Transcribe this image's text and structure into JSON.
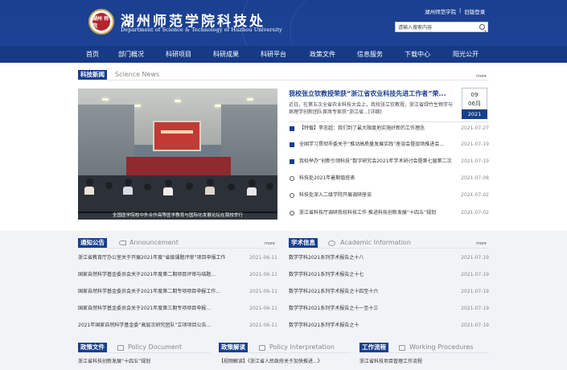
{
  "header": {
    "logo_text": "湖州\n师院",
    "title": "湖州师范学院科技处",
    "subtitle": "Department of Science & Technology of Huzhou University",
    "links": [
      "湖州师范学院",
      "|",
      "旧版登录"
    ],
    "search_placeholder": "请输入搜索内容"
  },
  "nav": {
    "items": [
      "首页",
      "部门概况",
      "科研项目",
      "科研成果",
      "科研平台",
      "政策文件",
      "信息服务",
      "下载中心",
      "阳光公开"
    ]
  },
  "news": {
    "title_cn": "科技新闻",
    "title_en": "Science News",
    "more": "more",
    "hero_caption": "全国医学院校中外合作高等医学教育与国际化发展论坛在我校举行",
    "headline": {
      "title": "我校张立钦教授荣获“浙江省农业科技先进工作者”荣...",
      "summary": "近日，在第五次全省农业科技大会上，我校张立钦教授，浙江省绿竹生物学与病理学创新团队首席专家获“浙江省...[详细]",
      "day": "09",
      "month": "06月",
      "year": "2021"
    },
    "items": [
      {
        "title": "【特载】李忠超：我们到了最大限度地实施好新的工作理念",
        "date": "2021-07-27"
      },
      {
        "title": "全国学习贯彻市委关于“推动高质量发展实践”座谈会暨现场推进会...",
        "date": "2021-07-19"
      },
      {
        "title": "我校举办“创新引领科技”数字研究会2021年学术研讨会暨第七届第二次...",
        "date": "2021-07-19"
      },
      {
        "title": "科技处2021年暑期值班表",
        "date": "2021-07-08"
      },
      {
        "title": "科技处深入二级学院开展调研座谈",
        "date": "2021-07-02"
      },
      {
        "title": "浙江省科技厅调研我校科技工作 推进科技创新发展“十四五”规划",
        "date": "2021-07-02"
      }
    ]
  },
  "notice": {
    "title_cn": "通知公告",
    "title_en": "Announcement",
    "more": "more",
    "items": [
      {
        "title": "浙江省教育厅办公室关于开展2021年度“省级课题评审”项目申报工作...",
        "date": "2021-06-11"
      },
      {
        "title": "国家自然科学基金委员会关于2021年度第二期项目评审与结题...",
        "date": "2021-06-11"
      },
      {
        "title": "国家自然科学基金委员会关于2021年度第二期专项项目申报工作...",
        "date": "2021-06-11"
      },
      {
        "title": "国家自然科学基金委员会关于2021年度第三期专项项目申报...",
        "date": "2021-06-11"
      },
      {
        "title": "2021年国家自然科学基金委“高层次研究团队”立项项目公告...",
        "date": "2021-06-11"
      }
    ]
  },
  "academic": {
    "title_cn": "学术信息",
    "title_en": "Academic Information",
    "more": "more",
    "items": [
      {
        "title": "数学学科2021系列学术报告之十八",
        "date": "2021-07-19"
      },
      {
        "title": "数学学科2021系列学术报告之十七",
        "date": "2021-07-19"
      },
      {
        "title": "数学学科2021系列学术报告之十四至十六",
        "date": "2021-07-19"
      },
      {
        "title": "数学学科2021系列学术报告之十一至十三",
        "date": "2021-07-19"
      },
      {
        "title": "数学学科2021系列学术报告之十",
        "date": "2021-07-19"
      }
    ]
  },
  "policy": {
    "title_cn": "政策文件",
    "title_en": "Policy Document",
    "first_item": "浙江省科技创新发展“十四五”规划"
  },
  "interpretation": {
    "title_cn": "政策解读",
    "title_en": "Policy Interpretation",
    "first_item": "【视频解读】《浙江省人民政府关于加快推进...》"
  },
  "workflow": {
    "title_cn": "工作流程",
    "title_en": "Working Procedures",
    "first_item": "浙江省科技项目管理工作流程"
  }
}
